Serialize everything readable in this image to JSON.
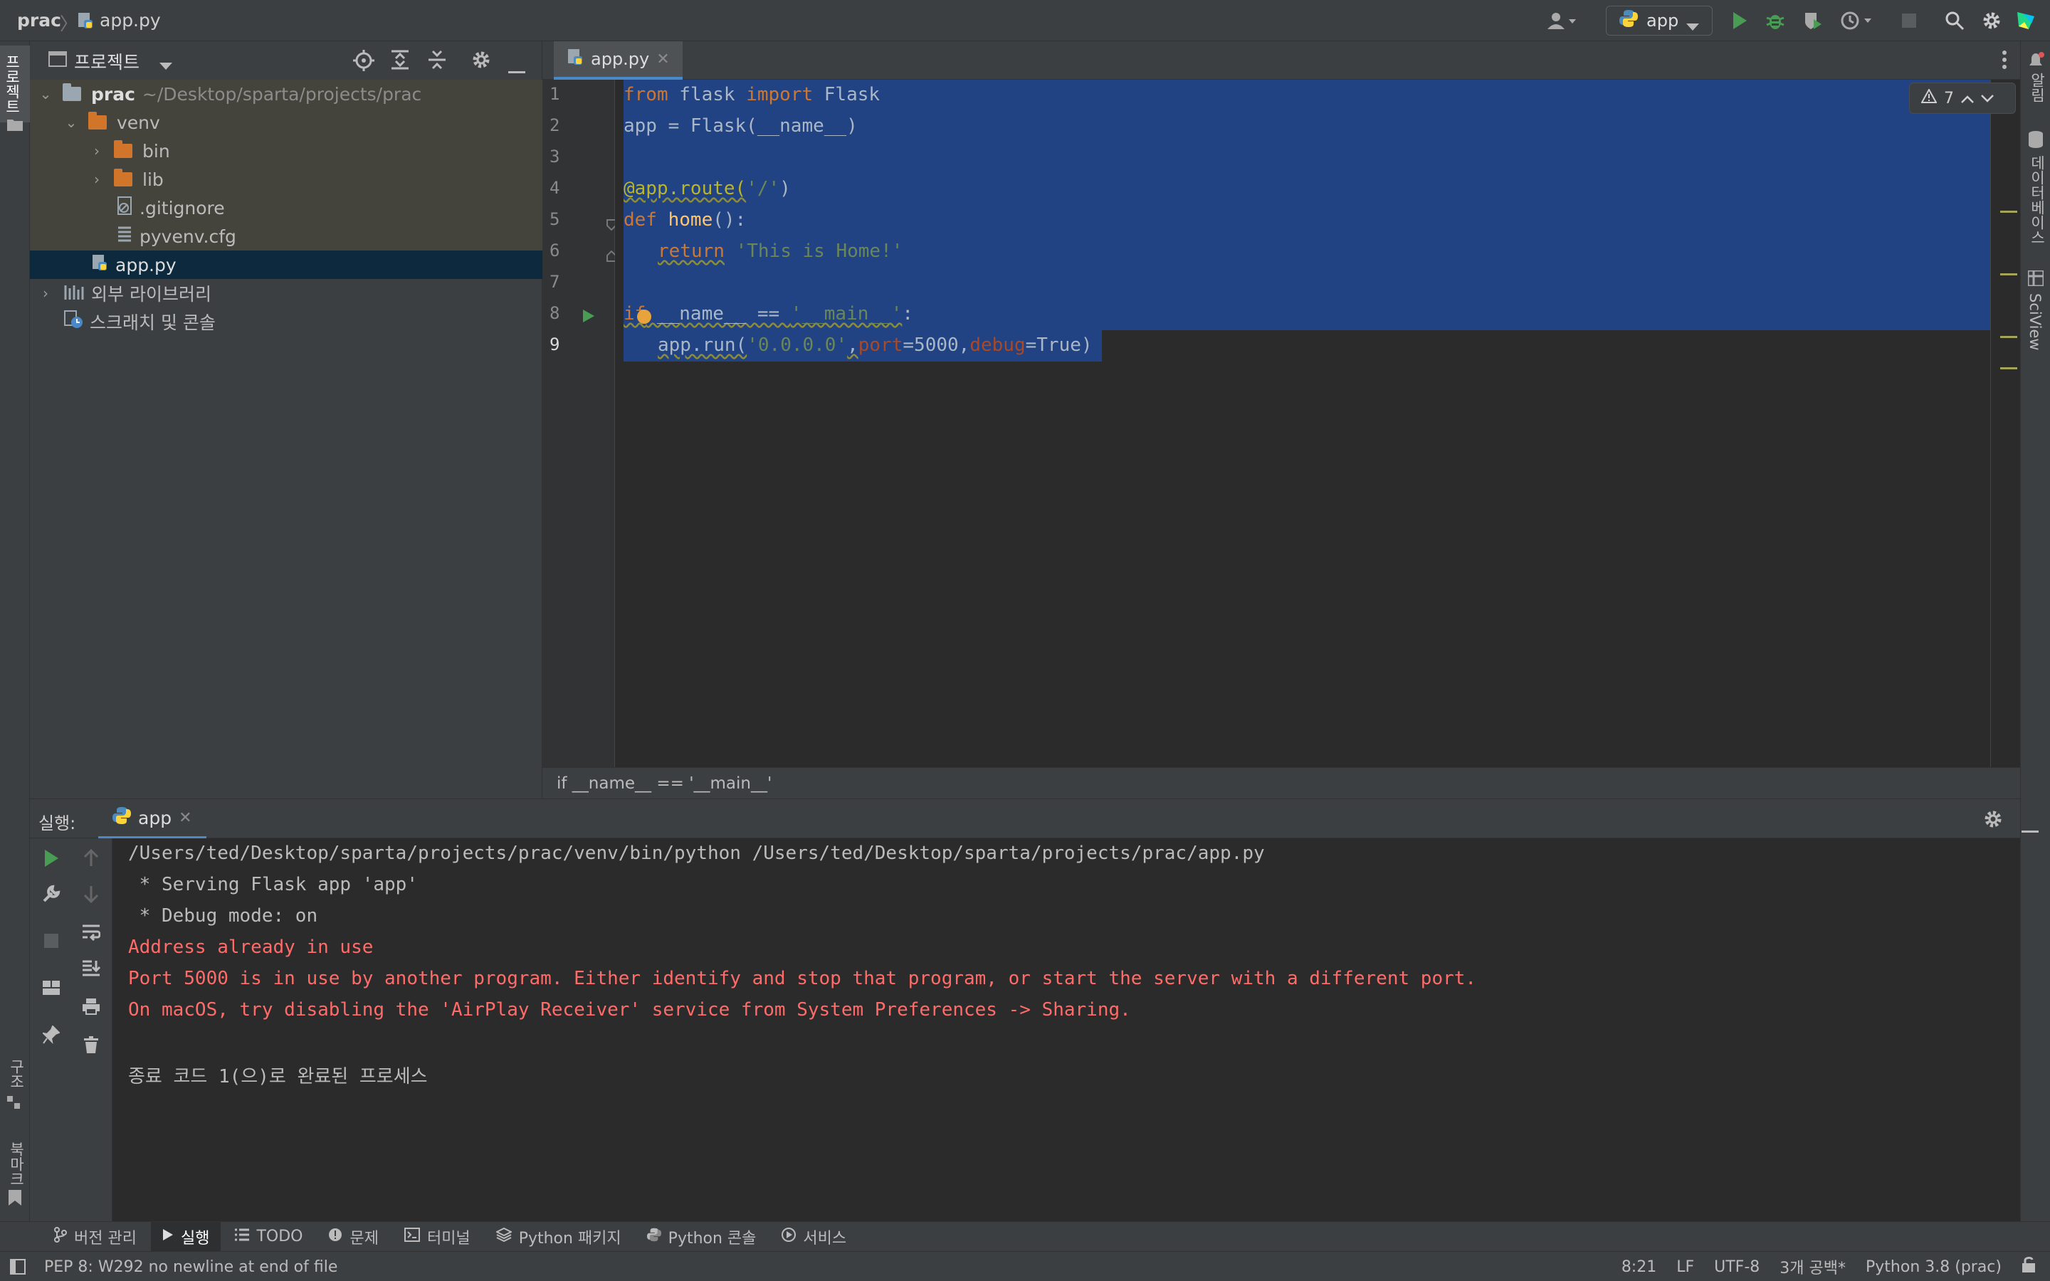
{
  "titlebar": {
    "project": "prac",
    "file": "app.py",
    "run_config": "app"
  },
  "sidebar_left": {
    "project_tab": "프로젝트",
    "structure_tab": "구조",
    "bookmark_tab": "북마크"
  },
  "sidebar_right": {
    "notifications_tab": "알림",
    "database_tab": "데이터베이스",
    "sciview_tab": "SciView"
  },
  "project_panel": {
    "title": "프로젝트",
    "root_name": "prac",
    "root_path": "~/Desktop/sparta/projects/prac",
    "items": [
      {
        "label": "venv"
      },
      {
        "label": "bin"
      },
      {
        "label": "lib"
      },
      {
        "label": ".gitignore"
      },
      {
        "label": "pyvenv.cfg"
      },
      {
        "label": "app.py"
      },
      {
        "label": "외부 라이브러리"
      },
      {
        "label": "스크래치 및 콘솔"
      }
    ]
  },
  "editor": {
    "tab_label": "app.py",
    "warning_count": "7",
    "line_numbers": [
      "1",
      "2",
      "3",
      "4",
      "5",
      "6",
      "7",
      "8",
      "9"
    ],
    "lines": {
      "l1": {
        "a": "from",
        "b": " flask ",
        "c": "import",
        "d": " Flask"
      },
      "l2": {
        "a": "app = Flask(__name__)"
      },
      "l4": {
        "a": "@app.route(",
        "b": "'/'",
        "c": ")"
      },
      "l5": {
        "a": "def",
        "b": " ",
        "c": "home",
        "d": "():"
      },
      "l6": {
        "a": "return",
        "b": " ",
        "c": "'This is Home!'"
      },
      "l8": {
        "a": "if",
        "b": " __name__ == ",
        "c": "'__main__'",
        "d": ":"
      },
      "l9": {
        "a": "app.run(",
        "b": "'0.0.0.0'",
        "c": ",",
        "d": "port",
        "e": "=5000,",
        "f": "debug",
        "g": "=True)"
      }
    },
    "breadcrumb": "if __name__ == '__main__'"
  },
  "run_panel": {
    "label": "실행:",
    "tab_label": "app",
    "console": [
      "/Users/ted/Desktop/sparta/projects/prac/venv/bin/python /Users/ted/Desktop/sparta/projects/prac/app.py",
      " * Serving Flask app 'app'",
      " * Debug mode: on",
      "Address already in use",
      "Port 5000 is in use by another program. Either identify and stop that program, or start the server with a different port.",
      "On macOS, try disabling the 'AirPlay Receiver' service from System Preferences -> Sharing.",
      "종료 코드 1(으)로 완료된 프로세스"
    ]
  },
  "tool_tabs": [
    {
      "label": "버전 관리"
    },
    {
      "label": "실행"
    },
    {
      "label": "TODO"
    },
    {
      "label": "문제"
    },
    {
      "label": "터미널"
    },
    {
      "label": "Python 패키지"
    },
    {
      "label": "Python 콘솔"
    },
    {
      "label": "서비스"
    }
  ],
  "statusbar": {
    "message": "PEP 8: W292 no newline at end of file",
    "position": "8:21",
    "line_sep": "LF",
    "encoding": "UTF-8",
    "indent": "3개 공백*",
    "interpreter": "Python 3.8 (prac)"
  },
  "colors": {
    "accent": "#4a88c7",
    "selection": "#214283",
    "error_text": "#ff6b68",
    "folder": "#d1752b",
    "run_green": "#499c54"
  }
}
